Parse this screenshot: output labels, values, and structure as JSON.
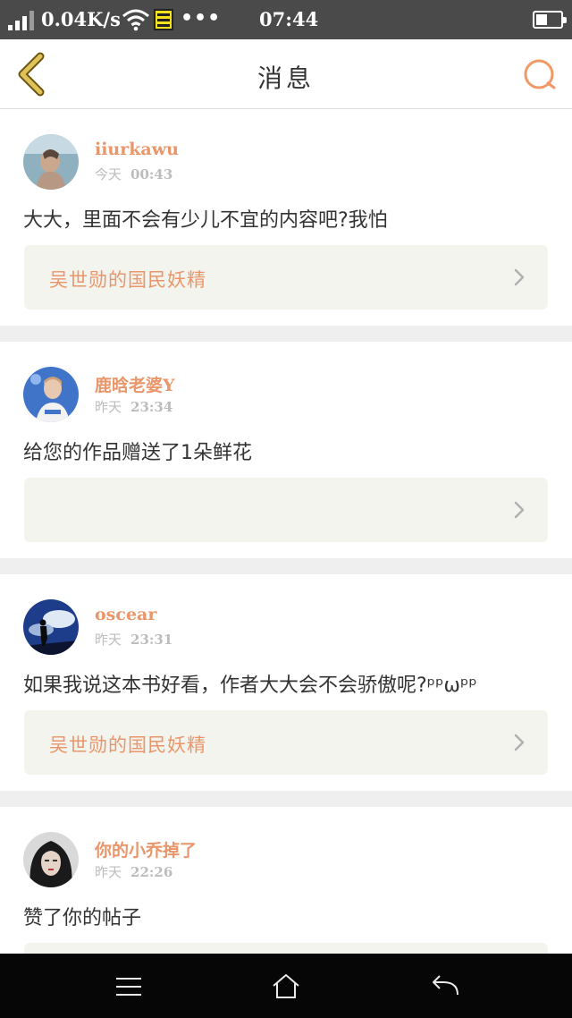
{
  "status_bar": {
    "speed": "0.04K/s",
    "dots": "•••",
    "time": "07:44",
    "battery_level": 0.45
  },
  "header": {
    "title": "消息"
  },
  "messages": [
    {
      "username": "iiurkawu",
      "day": "今天",
      "time": "00:43",
      "text": "大大，里面不会有少儿不宜的内容吧?我怕",
      "ref_title": "吴世勋的国民妖精"
    },
    {
      "username": "鹿晗老婆Y",
      "day": "昨天",
      "time": "23:34",
      "text": "给您的作品赠送了1朵鲜花",
      "ref_title": ""
    },
    {
      "username": "oscear",
      "day": "昨天",
      "time": "23:31",
      "text": "如果我说这本书好看，作者大大会不会骄傲呢?ᵖᵖωᵖᵖ",
      "ref_title": "吴世勋的国民妖精"
    },
    {
      "username": "你的小乔掉了",
      "day": "昨天",
      "time": "22:26",
      "text": "赞了你的帖子",
      "ref_title": ""
    }
  ],
  "icons": {
    "back": "chevron-left-icon",
    "search": "search-icon",
    "ref_arrow": "chevron-right-icon",
    "nav_menu": "menu-icon",
    "nav_home": "home-icon",
    "nav_back": "back-arrow-icon"
  },
  "colors": {
    "accent": "#e9966a",
    "back_icon": "#e0c25a",
    "search_icon": "#ef9a66",
    "status_bar": "#4a4a4a",
    "nav_bar": "#060606"
  }
}
